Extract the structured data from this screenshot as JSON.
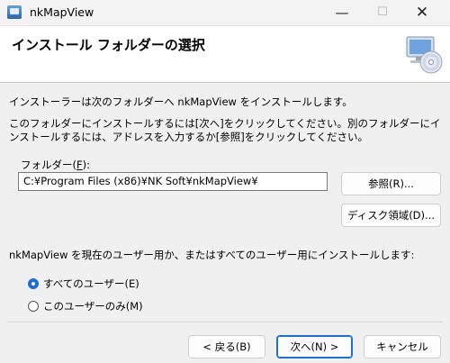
{
  "window": {
    "title": "nkMapView",
    "minimize_glyph": "—",
    "maximize_glyph": "☐",
    "close_glyph": "✕"
  },
  "header": {
    "title": "インストール フォルダーの選択",
    "icon": "computer-cd-icon"
  },
  "body": {
    "line1": "インストーラーは次のフォルダーへ nkMapView をインストールします。",
    "line2": "このフォルダーにインストールするには[次へ]をクリックしてください。別のフォルダーにインストールするには、アドレスを入力するか[参照]をクリックしてください。"
  },
  "folder": {
    "label_prefix": "フォルダー(",
    "label_key": "F",
    "label_suffix": "):",
    "value": "C:¥Program Files (x86)¥NK Soft¥nkMapView¥"
  },
  "buttons": {
    "browse": "参照(R)...",
    "disk_space": "ディスク領域(D)...",
    "back": "< 戻る(B)",
    "next": "次へ(N) >",
    "cancel": "キャンセル"
  },
  "install_for": {
    "question": "nkMapView を現在のユーザー用か、またはすべてのユーザー用にインストールします:",
    "options": [
      {
        "label": "すべてのユーザー(E)",
        "selected": true
      },
      {
        "label": "このユーザーのみ(M)",
        "selected": false
      }
    ]
  }
}
